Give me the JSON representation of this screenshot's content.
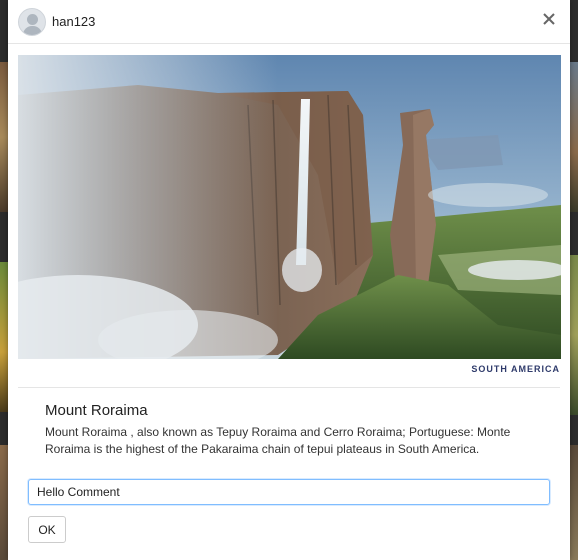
{
  "header": {
    "username": "han123",
    "avatar_icon": "user-avatar-icon",
    "close_icon": "close-icon"
  },
  "post": {
    "image_alt": "Mount Roraima waterfall cliffs",
    "region": "SOUTH AMERICA",
    "title": "Mount Roraima",
    "description": "Mount Roraima , also known as Tepuy Roraima and Cerro Roraima; Portuguese: Monte Roraima is the highest of the Pakaraima chain of tepui plateaus in South America."
  },
  "comment": {
    "value": "Hello Comment",
    "placeholder": ""
  },
  "actions": {
    "ok_label": "OK"
  },
  "colors": {
    "input_focus_border": "#80bdff",
    "region_text": "#2f3b6b"
  }
}
